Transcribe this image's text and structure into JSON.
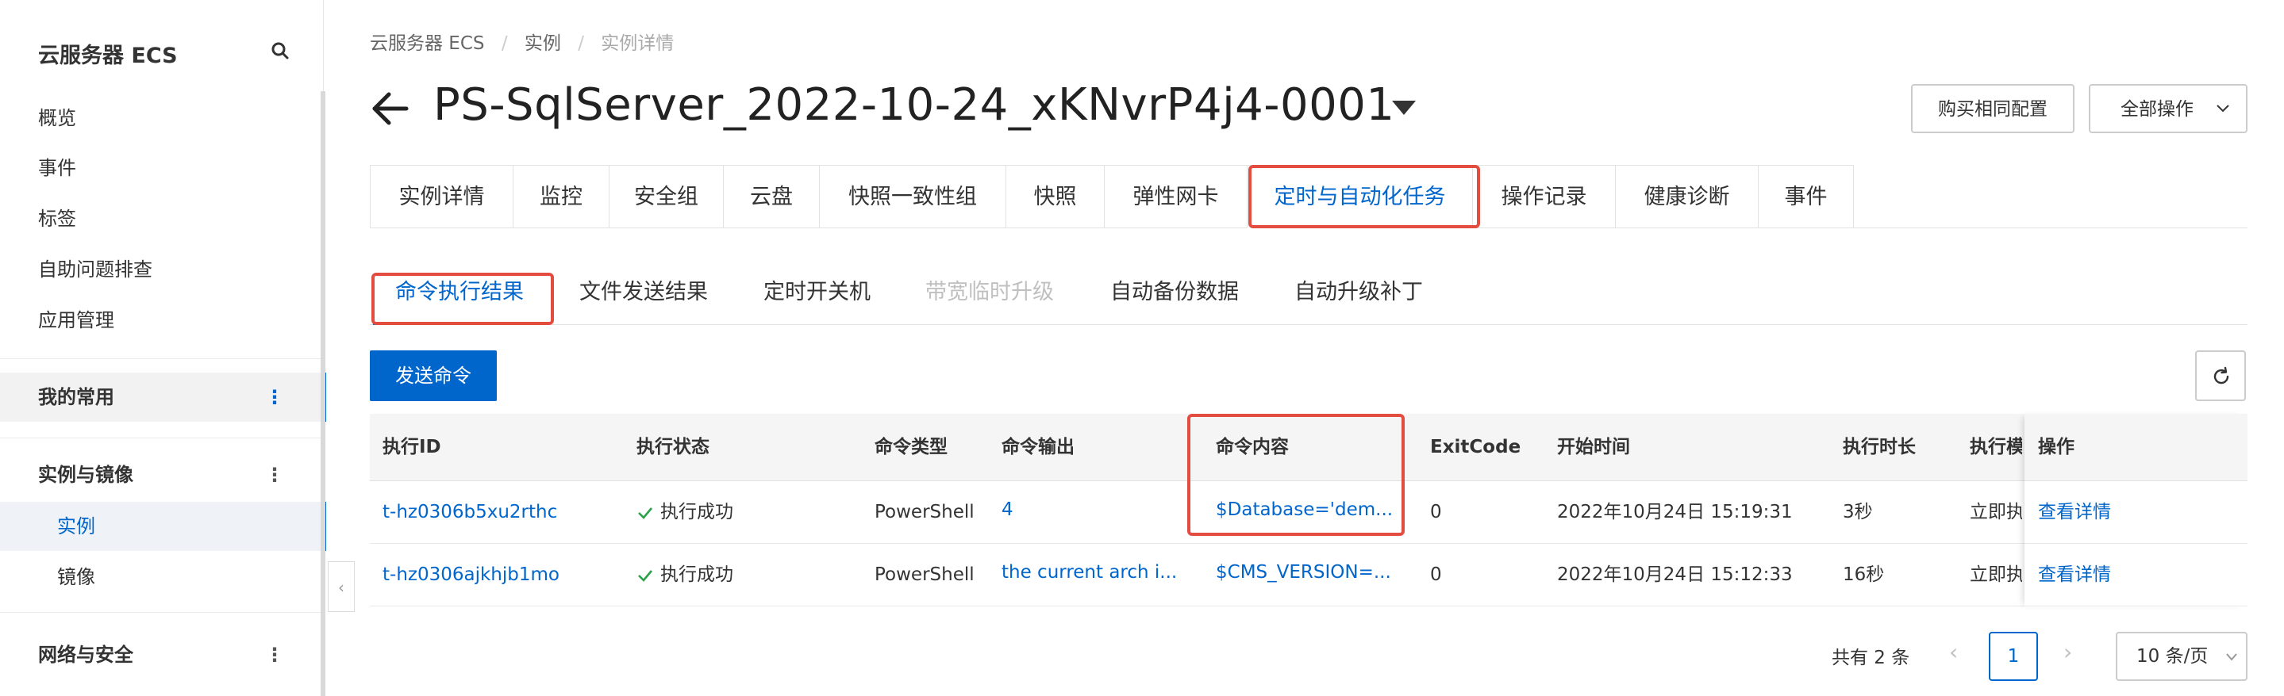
{
  "sidebar": {
    "title": "云服务器 ECS",
    "items": [
      "概览",
      "事件",
      "标签",
      "自助问题排查",
      "应用管理"
    ],
    "favorites": "我的常用",
    "group_instances": "实例与镜像",
    "sub_items": [
      "实例",
      "镜像"
    ],
    "group_network": "网络与安全",
    "collapse_glyph": "‹"
  },
  "breadcrumb": [
    "云服务器 ECS",
    "实例",
    "实例详情"
  ],
  "page_title": "PS-SqlServer_2022-10-24_xKNvrP4j4-0001",
  "header_buttons": {
    "buy_same": "购买相同配置",
    "all_actions": "全部操作"
  },
  "top_tabs": [
    "实例详情",
    "监控",
    "安全组",
    "云盘",
    "快照一致性组",
    "快照",
    "弹性网卡",
    "定时与自动化任务",
    "操作记录",
    "健康诊断",
    "事件"
  ],
  "active_top_tab": "定时与自动化任务",
  "sub_tabs": [
    "命令执行结果",
    "文件发送结果",
    "定时开关机",
    "带宽临时升级",
    "自动备份数据",
    "自动升级补丁"
  ],
  "toolbar": {
    "send_command": "发送命令"
  },
  "table": {
    "columns": [
      "执行ID",
      "执行状态",
      "命令类型",
      "命令输出",
      "命令内容",
      "ExitCode",
      "开始时间",
      "执行时长",
      "执行模",
      "操作"
    ],
    "rows": [
      {
        "id": "t-hz0306b5xu2rthc",
        "status": "执行成功",
        "type": "PowerShell",
        "output": "4",
        "content": "$Database='dem...",
        "exit_code": "0",
        "start_time": "2022年10月24日 15:19:31",
        "duration": "3秒",
        "mode": "立即执",
        "action": "查看详情"
      },
      {
        "id": "t-hz0306ajkhjb1mo",
        "status": "执行成功",
        "type": "PowerShell",
        "output": "the current arch i...",
        "content": "$CMS_VERSION=...",
        "exit_code": "0",
        "start_time": "2022年10月24日 15:12:33",
        "duration": "16秒",
        "mode": "立即执",
        "action": "查看详情"
      }
    ]
  },
  "pagination": {
    "total": "共有 2 条",
    "prev_glyph": "‹",
    "next_glyph": "›",
    "current_page": "1",
    "page_size": "10 条/页"
  },
  "colors": {
    "accent": "#0066cc",
    "highlight_box": "#e34d40",
    "success": "#2aa14b"
  }
}
